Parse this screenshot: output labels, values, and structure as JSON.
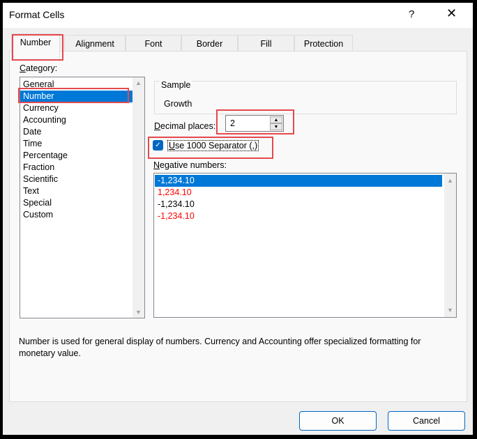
{
  "window": {
    "title": "Format Cells",
    "help": "?",
    "close": "✕"
  },
  "tabs": [
    "Number",
    "Alignment",
    "Font",
    "Border",
    "Fill",
    "Protection"
  ],
  "category": {
    "label_u": "C",
    "label_rest": "ategory:",
    "items": [
      "General",
      "Number",
      "Currency",
      "Accounting",
      "Date",
      "Time",
      "Percentage",
      "Fraction",
      "Scientific",
      "Text",
      "Special",
      "Custom"
    ],
    "selected": 1
  },
  "sample": {
    "label": "Sample",
    "value": "Growth"
  },
  "decimal": {
    "label_u": "D",
    "label_rest": "ecimal places:",
    "value": "2"
  },
  "separator": {
    "label_u": "U",
    "label_rest": "se 1000 Separator (,)",
    "checked": true
  },
  "negative": {
    "label_u": "N",
    "label_rest": "egative numbers:",
    "items": [
      {
        "text": "-1,234.10",
        "color": "#000000"
      },
      {
        "text": "1,234.10",
        "color": "#ff0000"
      },
      {
        "text": "-1,234.10",
        "color": "#000000"
      },
      {
        "text": "-1,234.10",
        "color": "#ff0000"
      }
    ],
    "selected": 0
  },
  "description": "Number is used for general display of numbers.  Currency and Accounting offer specialized formatting for monetary value.",
  "buttons": {
    "ok": "OK",
    "cancel": "Cancel"
  },
  "colors": {
    "accent": "#0078d7",
    "highlight": "#e5484d",
    "negative_red": "#ff0000"
  }
}
